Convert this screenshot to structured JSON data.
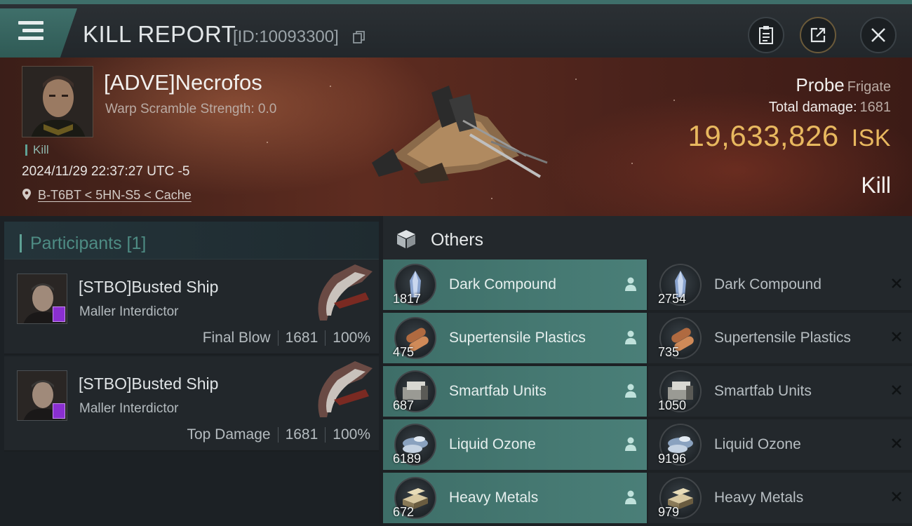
{
  "header": {
    "title": "KILL REPORT",
    "report_id": "[ID:10093300]"
  },
  "victim": {
    "name": "[ADVE]Necrofos",
    "warp_scramble": "Warp Scramble Strength: 0.0",
    "kill_tag": "Kill",
    "datetime": "2024/11/29 22:37:27 UTC -5",
    "location": "B-T6BT < 5HN-S5 < Cache",
    "ship_name": "Probe",
    "ship_class": "Frigate",
    "total_damage_label": "Total damage:",
    "total_damage": "1681",
    "isk_value": "19,633,826",
    "isk_unit": "ISK",
    "result": "Kill"
  },
  "participants": {
    "label": "Participants [1]",
    "rows": [
      {
        "name": "[STBO]Busted Ship",
        "ship": "Maller Interdictor",
        "role": "Final Blow",
        "damage": "1681",
        "percent": "100%"
      },
      {
        "name": "[STBO]Busted Ship",
        "ship": "Maller Interdictor",
        "role": "Top Damage",
        "damage": "1681",
        "percent": "100%"
      }
    ]
  },
  "others": {
    "title": "Others",
    "dropped": [
      {
        "name": "Dark Compound",
        "qty": "1817"
      },
      {
        "name": "Supertensile Plastics",
        "qty": "475"
      },
      {
        "name": "Smartfab Units",
        "qty": "687"
      },
      {
        "name": "Liquid Ozone",
        "qty": "6189"
      },
      {
        "name": "Heavy Metals",
        "qty": "672"
      }
    ],
    "destroyed": [
      {
        "name": "Dark Compound",
        "qty": "2754"
      },
      {
        "name": "Supertensile Plastics",
        "qty": "735"
      },
      {
        "name": "Smartfab Units",
        "qty": "1050"
      },
      {
        "name": "Liquid Ozone",
        "qty": "9196"
      },
      {
        "name": "Heavy Metals",
        "qty": "979"
      }
    ]
  },
  "colors": {
    "accent": "#4e8c84",
    "isk": "#e8b85f",
    "dropped_bg": "#4a7f78"
  },
  "icons": {
    "menu": "menu-icon",
    "copy": "copy-icon",
    "clipboard": "clipboard-icon",
    "share": "share-icon",
    "close": "close-icon",
    "location": "map-pin-icon",
    "others": "cube-icon",
    "dropped_owner": "person-icon",
    "destroyed": "x-icon"
  }
}
